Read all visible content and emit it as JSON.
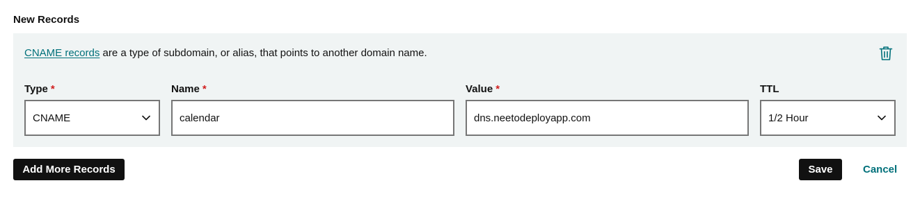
{
  "section": {
    "title": "New Records"
  },
  "record": {
    "info_link": "CNAME records",
    "info_text": " are a type of subdomain, or alias, that points to another domain name.",
    "fields": {
      "type": {
        "label": "Type",
        "required_mark": "*",
        "value": "CNAME"
      },
      "name": {
        "label": "Name",
        "required_mark": "*",
        "value": "calendar"
      },
      "value": {
        "label": "Value",
        "required_mark": "*",
        "value": "dns.neetodeployapp.com"
      },
      "ttl": {
        "label": "TTL",
        "value": "1/2 Hour"
      }
    }
  },
  "actions": {
    "add_more": "Add More Records",
    "save": "Save",
    "cancel": "Cancel"
  },
  "colors": {
    "panel_bg": "#f0f4f4",
    "link": "#00707a",
    "required": "#d11f1f",
    "button_bg": "#111111"
  },
  "icons": {
    "delete": "trash-icon",
    "dropdown": "chevron-down-icon"
  }
}
